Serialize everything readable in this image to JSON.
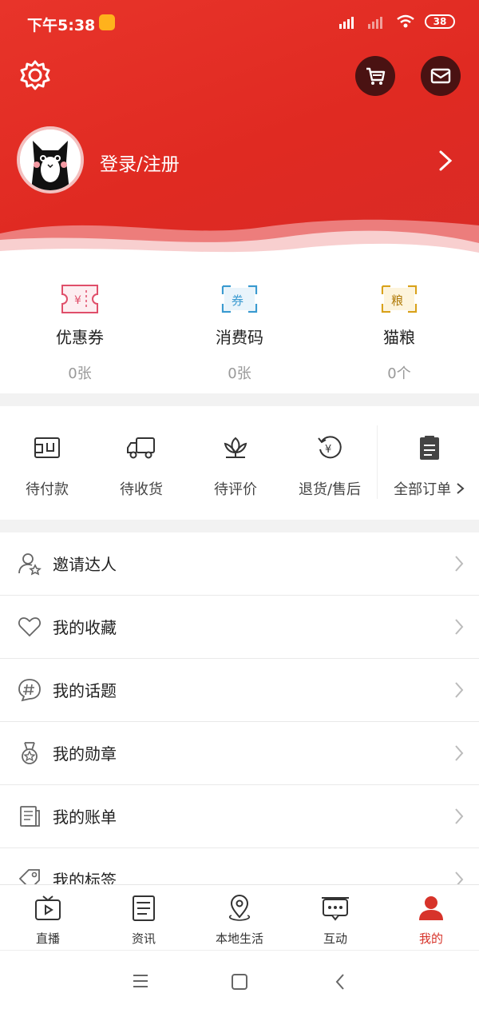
{
  "status_bar": {
    "time": "下午5:38",
    "battery": "38"
  },
  "header": {
    "login_text": "登录/注册"
  },
  "wallet": [
    {
      "label": "优惠券",
      "count": "0张",
      "icon": "coupon-icon",
      "icon_text": "¥",
      "color": "#e04f6a"
    },
    {
      "label": "消费码",
      "count": "0张",
      "icon": "ticket-icon",
      "icon_text": "券",
      "color": "#3a9ad0"
    },
    {
      "label": "猫粮",
      "count": "0个",
      "icon": "cat-food-icon",
      "icon_text": "粮",
      "color": "#d9a21b"
    }
  ],
  "orders": [
    {
      "label": "待付款",
      "icon": "wallet-icon"
    },
    {
      "label": "待收货",
      "icon": "truck-icon"
    },
    {
      "label": "待评价",
      "icon": "flower-icon"
    },
    {
      "label": "退货/售后",
      "icon": "refund-icon"
    },
    {
      "label": "全部订单",
      "icon": "clipboard-icon"
    }
  ],
  "menu": [
    {
      "label": "邀请达人",
      "icon": "invite-user-icon"
    },
    {
      "label": "我的收藏",
      "icon": "heart-icon"
    },
    {
      "label": "我的话题",
      "icon": "hashtag-icon"
    },
    {
      "label": "我的勋章",
      "icon": "medal-icon"
    },
    {
      "label": "我的账单",
      "icon": "bill-icon"
    },
    {
      "label": "我的标签",
      "icon": "tag-icon"
    }
  ],
  "tabs": [
    {
      "label": "直播",
      "icon": "tv-icon"
    },
    {
      "label": "资讯",
      "icon": "news-icon"
    },
    {
      "label": "本地生活",
      "icon": "location-icon"
    },
    {
      "label": "互动",
      "icon": "chat-icon"
    },
    {
      "label": "我的",
      "icon": "user-icon",
      "active": true
    }
  ],
  "colors": {
    "brand_red": "#e02a22",
    "active_tab": "#d7332a"
  }
}
